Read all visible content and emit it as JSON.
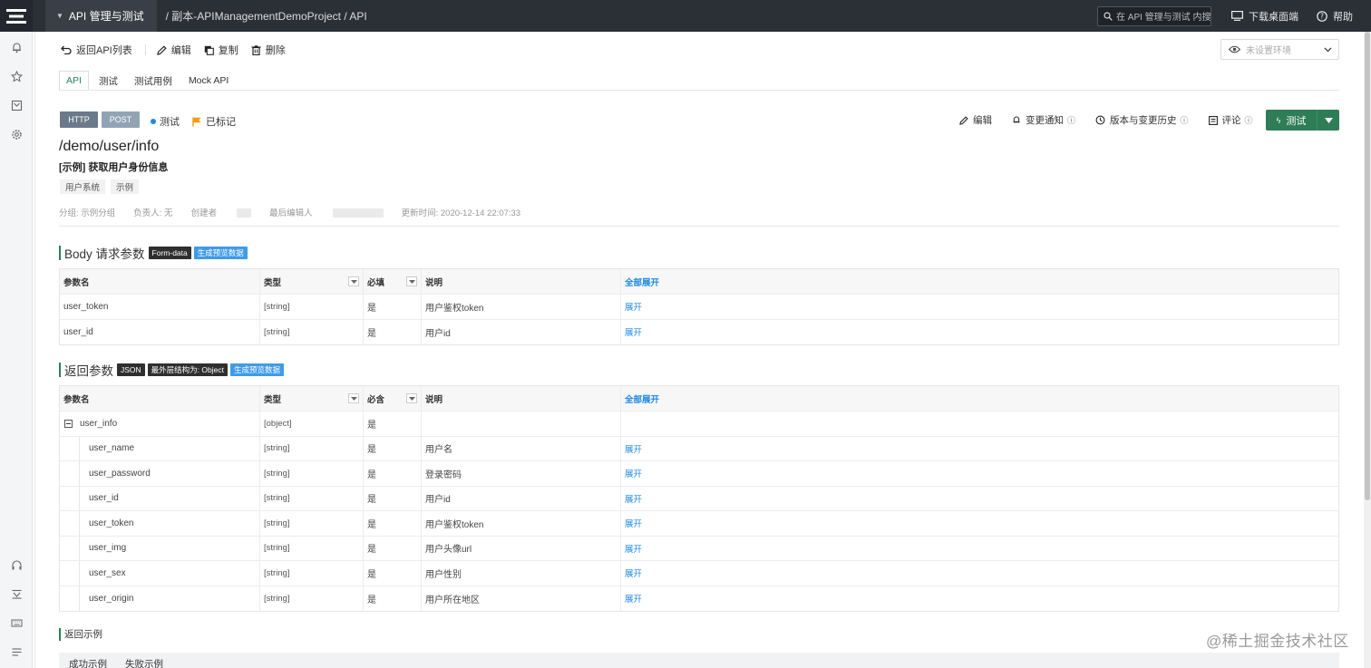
{
  "topbar": {
    "module": "API 管理与测试",
    "breadcrumb": "/ 副本-APIManagementDemoProject / API",
    "search_placeholder": "在 API 管理与测试 内搜索",
    "download": "下载桌面端",
    "help": "帮助"
  },
  "toolbar": {
    "back": "返回API列表",
    "edit": "编辑",
    "copy": "复制",
    "delete": "删除",
    "env_placeholder": "未设置环境"
  },
  "tabs": [
    "API",
    "测试",
    "测试用例",
    "Mock API"
  ],
  "api": {
    "protocol": "HTTP",
    "method": "POST",
    "status": "测试",
    "flag": "已标记",
    "path": "/demo/user/info",
    "name": "[示例] 获取用户身份信息",
    "tags": [
      "用户系统",
      "示例"
    ],
    "meta": {
      "group": "分组: 示例分组",
      "owner": "负责人: 无",
      "creator": "创建者",
      "last_editor": "最后编辑人",
      "updated": "更新时间: 2020-12-14 22:07:33"
    }
  },
  "actions": {
    "edit": "编辑",
    "notify": "变更通知",
    "history": "版本与变更历史",
    "comment": "评论",
    "test": "测试"
  },
  "body_section": {
    "title": "Body 请求参数",
    "pill1": "Form-data",
    "pill2": "生成预览数据",
    "headers": [
      "参数名",
      "类型",
      "必填",
      "说明",
      "全部展开"
    ],
    "rows": [
      {
        "name": "user_token",
        "type": "[string]",
        "req": "是",
        "desc": "用户鉴权token",
        "action": "展开"
      },
      {
        "name": "user_id",
        "type": "[string]",
        "req": "是",
        "desc": "用户id",
        "action": "展开"
      }
    ]
  },
  "return_section": {
    "title": "返回参数",
    "pill1": "JSON",
    "pill2": "最外层结构为: Object",
    "pill3": "生成预览数据",
    "headers": [
      "参数名",
      "类型",
      "必含",
      "说明",
      "全部展开"
    ],
    "parent": {
      "name": "user_info",
      "type": "[object]",
      "req": "是"
    },
    "rows": [
      {
        "name": "user_name",
        "type": "[string]",
        "req": "是",
        "desc": "用户名",
        "action": "展开"
      },
      {
        "name": "user_password",
        "type": "[string]",
        "req": "是",
        "desc": "登录密码",
        "action": "展开"
      },
      {
        "name": "user_id",
        "type": "[string]",
        "req": "是",
        "desc": "用户id",
        "action": "展开"
      },
      {
        "name": "user_token",
        "type": "[string]",
        "req": "是",
        "desc": "用户鉴权token",
        "action": "展开"
      },
      {
        "name": "user_img",
        "type": "[string]",
        "req": "是",
        "desc": "用户头像url",
        "action": "展开"
      },
      {
        "name": "user_sex",
        "type": "[string]",
        "req": "是",
        "desc": "用户性别",
        "action": "展开"
      },
      {
        "name": "user_origin",
        "type": "[string]",
        "req": "是",
        "desc": "用户所在地区",
        "action": "展开"
      }
    ]
  },
  "example": {
    "title": "返回示例",
    "tabs": [
      "成功示例",
      "失败示例"
    ]
  },
  "watermark": "@稀土掘金技术社区",
  "colors": {
    "accent": "#2e7d57",
    "link": "#1e88e5",
    "topbar": "#2b2f36"
  }
}
